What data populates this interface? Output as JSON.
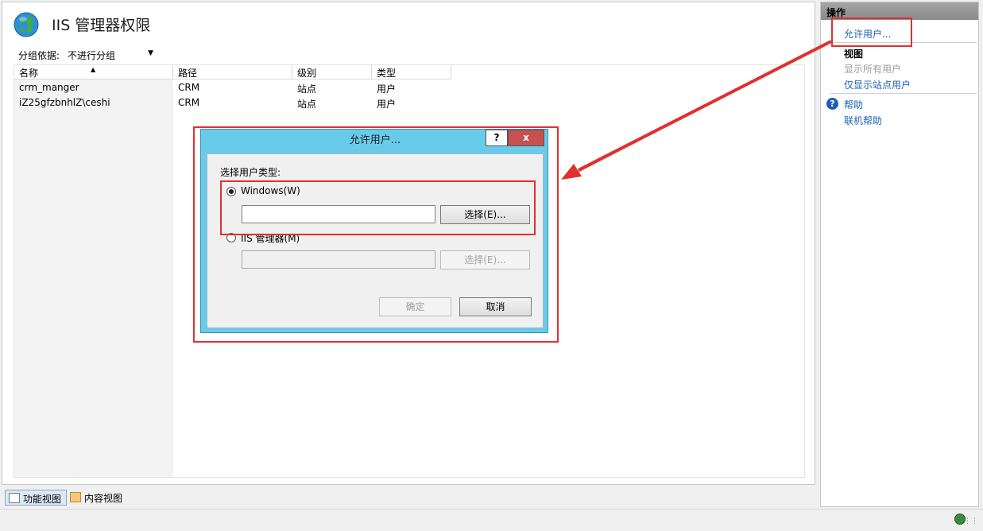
{
  "main": {
    "title": "IIS 管理器权限",
    "group_by_label": "分组依据:",
    "group_by_value": "不进行分组",
    "columns": [
      "名称",
      "路径",
      "级别",
      "类型"
    ],
    "rows": [
      [
        "crm_manger",
        "CRM",
        "站点",
        "用户"
      ],
      [
        "iZ25gfzbnhlZ\\ceshi",
        "CRM",
        "站点",
        "用户"
      ]
    ]
  },
  "tabs": {
    "feature_view": "功能视图",
    "content_view": "内容视图"
  },
  "actions": {
    "header": "操作",
    "allow_user": "允许用户...",
    "view_header": "视图",
    "show_all_users": "显示所有用户",
    "show_site_users": "仅显示站点用户",
    "help": "帮助",
    "online_help": "联机帮助"
  },
  "dialog": {
    "title": "允许用户...",
    "help_btn": "?",
    "close_btn": "x",
    "select_type_label": "选择用户类型:",
    "windows_option": "Windows(W)",
    "windows_select_btn": "选择(E)...",
    "iis_option": "IIS 管理器(M)",
    "iis_select_btn": "选择(E)...",
    "ok_btn": "确定",
    "cancel_btn": "取消"
  },
  "colors": {
    "annotation_red": "#e03030",
    "link_blue": "#1d63b5",
    "dialog_frame": "#69cbea"
  }
}
